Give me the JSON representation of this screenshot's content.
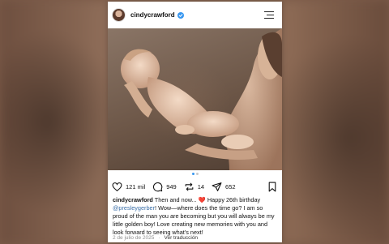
{
  "post": {
    "username": "cindycrawford",
    "stats": {
      "likes": "121 mil",
      "comments": "949",
      "reposts": "14",
      "shares": "652"
    },
    "caption": {
      "author": "cindycrawford",
      "part1": "Then and now...",
      "emoji": "❤️",
      "part2": "Happy 26th birthday",
      "mention": "@presleygerber",
      "part3": "! Wow—where does the time go? I am so proud of the man you are becoming but you will always be my little golden boy! Love creating new memories with you and look forward to seeing what's next!"
    },
    "date": "2 de julio de 2025",
    "translate": "Ver traducción",
    "carousel": {
      "total": 2,
      "active": 1
    },
    "colors": {
      "accent": "#3897f0",
      "mention": "#3a6fa8",
      "heart": "#e0245e"
    }
  }
}
